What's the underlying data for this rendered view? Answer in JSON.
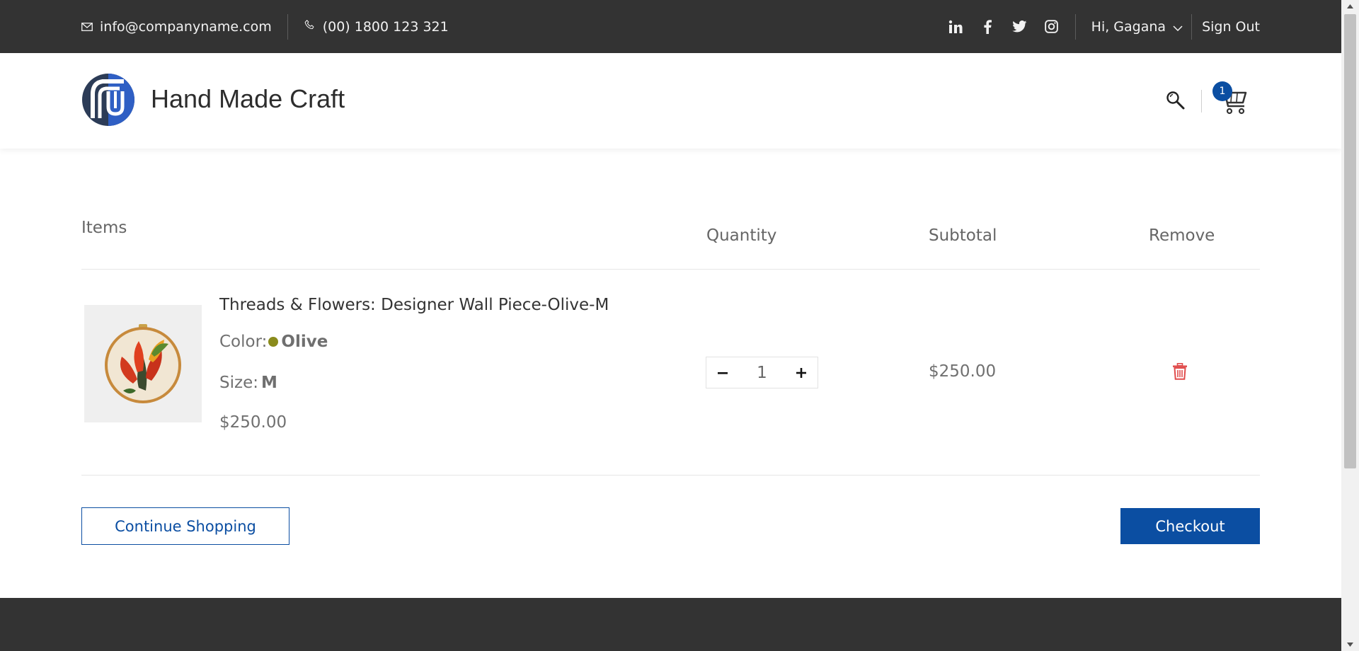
{
  "topbar": {
    "email": "info@companyname.com",
    "phone": "(00) 1800 123 321",
    "social": [
      "linkedin-icon",
      "facebook-icon",
      "twitter-icon",
      "instagram-icon"
    ],
    "greeting": "Hi, Gagana",
    "sign_out": "Sign Out"
  },
  "header": {
    "brand": "Hand Made Craft",
    "cart_count": "1"
  },
  "cart": {
    "columns": {
      "items": "Items",
      "quantity": "Quantity",
      "subtotal": "Subtotal",
      "remove": "Remove"
    },
    "rows": [
      {
        "name": "Threads & Flowers: Designer Wall Piece-Olive-M",
        "color_label": "Color:",
        "color_value": "Olive",
        "color_hex": "#8a8b1c",
        "size_label": "Size:",
        "size_value": "M",
        "price": "$250.00",
        "quantity": "1",
        "subtotal": "$250.00"
      }
    ],
    "continue_label": "Continue Shopping",
    "checkout_label": "Checkout"
  },
  "colors": {
    "topbar_bg": "#333333",
    "accent": "#0b4ea2",
    "remove": "#e04b4b"
  }
}
